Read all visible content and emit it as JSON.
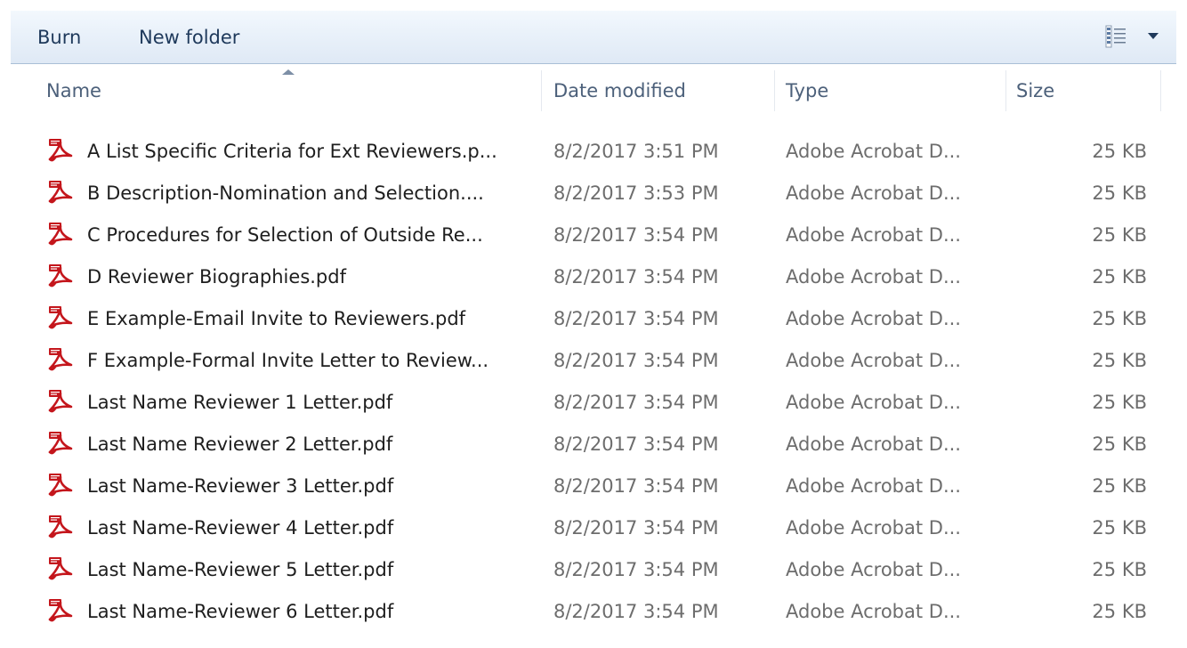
{
  "toolbar": {
    "burn_label": "Burn",
    "new_folder_label": "New folder",
    "view_icon": "details-view-icon",
    "view_dropdown_icon": "chevron-down-icon"
  },
  "columns": {
    "name": "Name",
    "date_modified": "Date modified",
    "type": "Type",
    "size": "Size",
    "sort_icon": "sort-ascending-icon"
  },
  "colors": {
    "toolbar_text": "#1e395b",
    "header_text": "#4c607a",
    "secondary_text": "#6d6d6d",
    "pdf_red": "#c4161c"
  },
  "files": [
    {
      "icon": "pdf-icon",
      "name": "A List Specific Criteria for Ext Reviewers.p...",
      "date": "8/2/2017 3:51 PM",
      "type": "Adobe Acrobat D...",
      "size": "25 KB"
    },
    {
      "icon": "pdf-icon",
      "name": "B Description-Nomination and Selection....",
      "date": "8/2/2017 3:53 PM",
      "type": "Adobe Acrobat D...",
      "size": "25 KB"
    },
    {
      "icon": "pdf-icon",
      "name": "C Procedures for Selection of Outside Re...",
      "date": "8/2/2017 3:54 PM",
      "type": "Adobe Acrobat D...",
      "size": "25 KB"
    },
    {
      "icon": "pdf-icon",
      "name": "D Reviewer Biographies.pdf",
      "date": "8/2/2017 3:54 PM",
      "type": "Adobe Acrobat D...",
      "size": "25 KB"
    },
    {
      "icon": "pdf-icon",
      "name": "E Example-Email Invite to Reviewers.pdf",
      "date": "8/2/2017 3:54 PM",
      "type": "Adobe Acrobat D...",
      "size": "25 KB"
    },
    {
      "icon": "pdf-icon",
      "name": "F Example-Formal Invite Letter to Review...",
      "date": "8/2/2017 3:54 PM",
      "type": "Adobe Acrobat D...",
      "size": "25 KB"
    },
    {
      "icon": "pdf-icon",
      "name": "Last Name Reviewer 1 Letter.pdf",
      "date": "8/2/2017 3:54 PM",
      "type": "Adobe Acrobat D...",
      "size": "25 KB"
    },
    {
      "icon": "pdf-icon",
      "name": "Last Name Reviewer 2 Letter.pdf",
      "date": "8/2/2017 3:54 PM",
      "type": "Adobe Acrobat D...",
      "size": "25 KB"
    },
    {
      "icon": "pdf-icon",
      "name": "Last Name-Reviewer 3 Letter.pdf",
      "date": "8/2/2017 3:54 PM",
      "type": "Adobe Acrobat D...",
      "size": "25 KB"
    },
    {
      "icon": "pdf-icon",
      "name": "Last Name-Reviewer 4 Letter.pdf",
      "date": "8/2/2017 3:54 PM",
      "type": "Adobe Acrobat D...",
      "size": "25 KB"
    },
    {
      "icon": "pdf-icon",
      "name": "Last Name-Reviewer 5 Letter.pdf",
      "date": "8/2/2017 3:54 PM",
      "type": "Adobe Acrobat D...",
      "size": "25 KB"
    },
    {
      "icon": "pdf-icon",
      "name": "Last Name-Reviewer 6 Letter.pdf",
      "date": "8/2/2017 3:54 PM",
      "type": "Adobe Acrobat D...",
      "size": "25 KB"
    }
  ]
}
